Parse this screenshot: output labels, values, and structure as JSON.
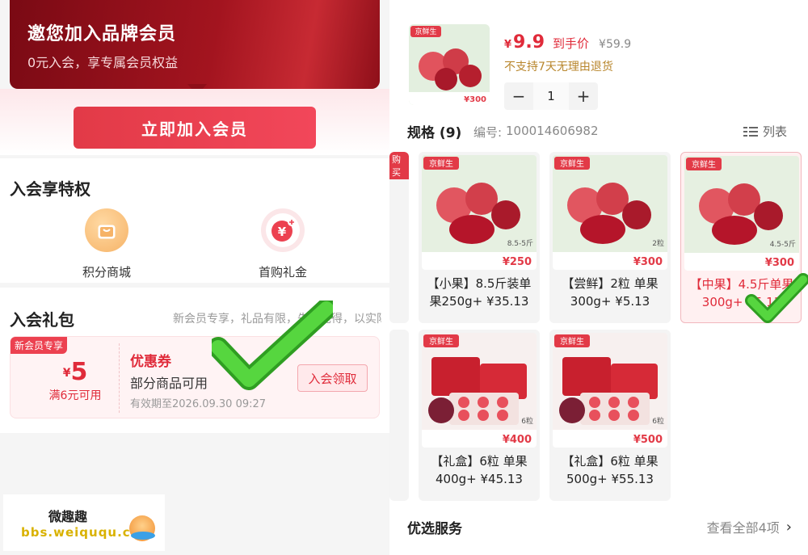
{
  "left": {
    "banner": {
      "title": "邀您加入品牌会员",
      "subtitle": "0元入会，享专属会员权益"
    },
    "join_button": "立即加入会员",
    "privileges": {
      "title": "入会享特权",
      "items": [
        {
          "label": "积分商城",
          "icon": "shopping-bag-icon"
        },
        {
          "label": "首购礼金",
          "icon": "yuan-plus-icon"
        }
      ]
    },
    "gift_pack": {
      "title": "入会礼包",
      "note": "新会员专享，礼品有限，先到先得，以实际使用为准",
      "coupon": {
        "tag": "新会员专享",
        "currency": "¥",
        "amount": "5",
        "min_spend": "满6元可用",
        "type": "优惠券",
        "scope": "部分商品可用",
        "expiry": "有效期至2026.09.30 09:27",
        "button": "入会领取"
      }
    },
    "watermark": {
      "line1": "微趣趣",
      "line2": "bbs.weiququ.cn"
    }
  },
  "right": {
    "product": {
      "currency": "¥",
      "price": "9.9",
      "price_label": "到手价",
      "original_price": "¥59.9",
      "return_policy": "不支持7天无理由退货",
      "quantity": "1",
      "minus": "−",
      "plus": "+",
      "thumb_badge": "京鲜生",
      "thumb_price": "¥300"
    },
    "specs": {
      "title": "规格 (9)",
      "code_label": "编号:",
      "code": "100014606982",
      "list_label": "列表",
      "cut_tag": "购买",
      "items": [
        {
          "line1": "【小果】8.5斤装单",
          "line2": "果250g+ ¥35.13",
          "badge": "京鲜生",
          "price_tag": "¥250",
          "weight_tag": "8.5-5斤"
        },
        {
          "line1": "【尝鲜】2粒 单果",
          "line2": "300g+ ¥5.13",
          "badge": "京鲜生",
          "price_tag": "¥300",
          "weight_tag": "2粒"
        },
        {
          "line1": "【中果】4.5斤单果",
          "line2": "300g+ ¥5.13",
          "badge": "京鲜生",
          "price_tag": "¥300",
          "weight_tag": "4.5-5斤"
        },
        {
          "line1": "【礼盒】6粒 单果",
          "line2": "400g+ ¥45.13",
          "badge": "京鲜生",
          "price_tag": "¥400",
          "weight_tag": "6粒"
        },
        {
          "line1": "【礼盒】6粒 单果",
          "line2": "500g+ ¥55.13",
          "badge": "京鲜生",
          "price_tag": "¥500",
          "weight_tag": "6粒"
        }
      ]
    },
    "services": {
      "title": "优选服务",
      "more": "查看全部4项",
      "arrow": "›"
    }
  },
  "colors": {
    "brand_red": "#e02b3a",
    "banner_dark": "#7a0a14",
    "check_green": "#3fbf2f"
  }
}
